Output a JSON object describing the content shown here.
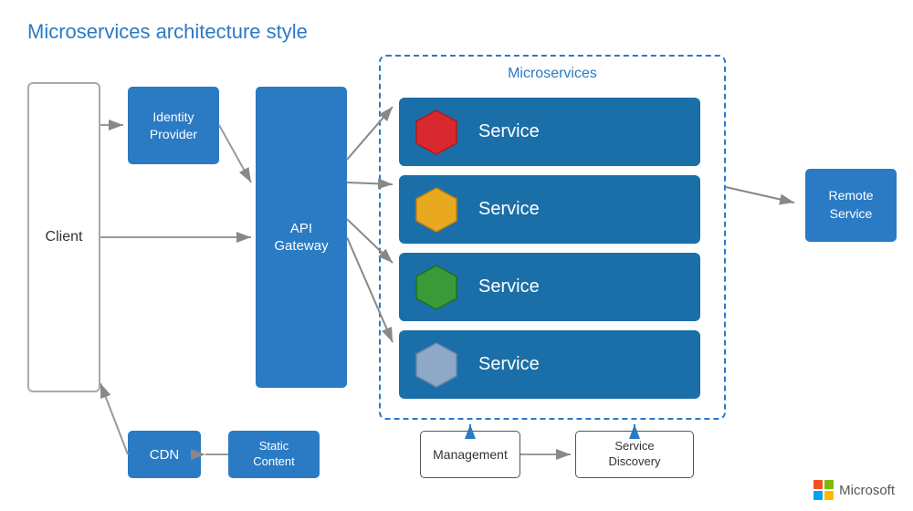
{
  "title": "Microservices architecture style",
  "client": "Client",
  "identity_provider": "Identity\nProvider",
  "api_gateway": "API\nGateway",
  "microservices_label": "Microservices",
  "services": [
    {
      "label": "Service",
      "hex_color": "#d9282f"
    },
    {
      "label": "Service",
      "hex_color": "#e8a820"
    },
    {
      "label": "Service",
      "hex_color": "#3a9a3a"
    },
    {
      "label": "Service",
      "hex_color": "#8fa8c8"
    }
  ],
  "remote_service": "Remote\nService",
  "cdn": "CDN",
  "static_content": "Static\nContent",
  "management": "Management",
  "service_discovery": "Service\nDiscovery",
  "microsoft": "Microsoft"
}
